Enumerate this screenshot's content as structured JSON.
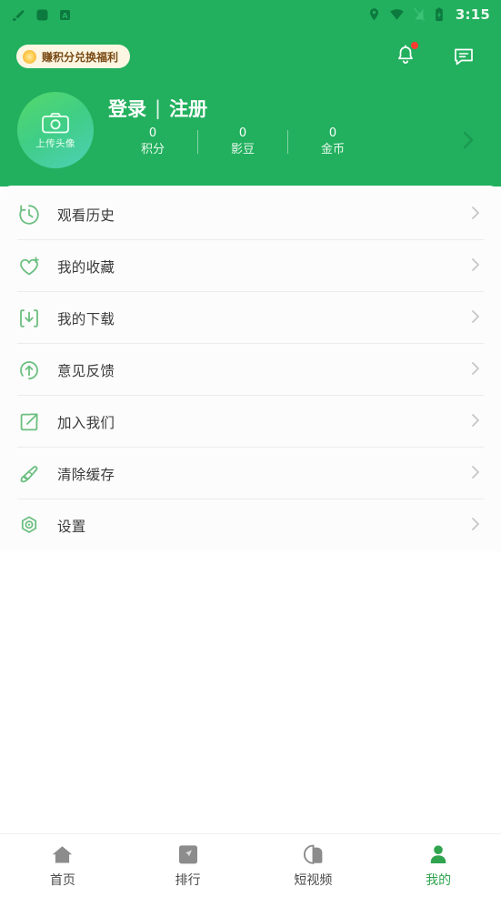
{
  "theme": {
    "header_green": "#22b05e",
    "accent_green": "#30a44f",
    "promo_bg": "#fdf6e3",
    "promo_text_color": "#7a4a15",
    "badge_red": "#ff3b30",
    "card_bg": "#fcfcfc"
  },
  "status_bar": {
    "time": "3:15",
    "left_icons": [
      "brush-notification-icon",
      "app-notification-icon",
      "letter-a-notification-icon"
    ],
    "right_icons": [
      "location-icon",
      "wifi-icon",
      "signal-off-icon",
      "battery-icon"
    ]
  },
  "header": {
    "promo": {
      "icon": "coin-icon",
      "label": "赚积分兑换福利"
    },
    "actions": [
      {
        "name": "notifications-button",
        "icon": "bell-icon",
        "has_badge": true
      },
      {
        "name": "messages-button",
        "icon": "chat-icon",
        "has_badge": false
      }
    ],
    "avatar": {
      "icon": "camera-icon",
      "label": "上传头像"
    },
    "login": {
      "login_label": "登录",
      "separator": "|",
      "register_label": "注册"
    },
    "stats": [
      {
        "value": "0",
        "label": "积分"
      },
      {
        "value": "0",
        "label": "影豆"
      },
      {
        "value": "0",
        "label": "金币"
      }
    ],
    "profile_arrow_icon": "chevron-right-icon"
  },
  "menu": {
    "items": [
      {
        "label": "观看历史",
        "icon": "history-icon"
      },
      {
        "label": "我的收藏",
        "icon": "heart-plus-icon"
      },
      {
        "label": "我的下载",
        "icon": "download-icon"
      },
      {
        "label": "意见反馈",
        "icon": "feedback-arrow-up-icon"
      },
      {
        "label": "加入我们",
        "icon": "external-link-icon"
      },
      {
        "label": "清除缓存",
        "icon": "brush-icon"
      },
      {
        "label": "设置",
        "icon": "settings-hexagon-icon"
      }
    ],
    "arrow_icon": "chevron-right-icon"
  },
  "bottom_nav": {
    "items": [
      {
        "label": "首页",
        "icon": "home-icon",
        "active": false
      },
      {
        "label": "排行",
        "icon": "compass-icon",
        "active": false
      },
      {
        "label": "短视频",
        "icon": "short-video-icon",
        "active": false
      },
      {
        "label": "我的",
        "icon": "person-icon",
        "active": true
      }
    ]
  }
}
